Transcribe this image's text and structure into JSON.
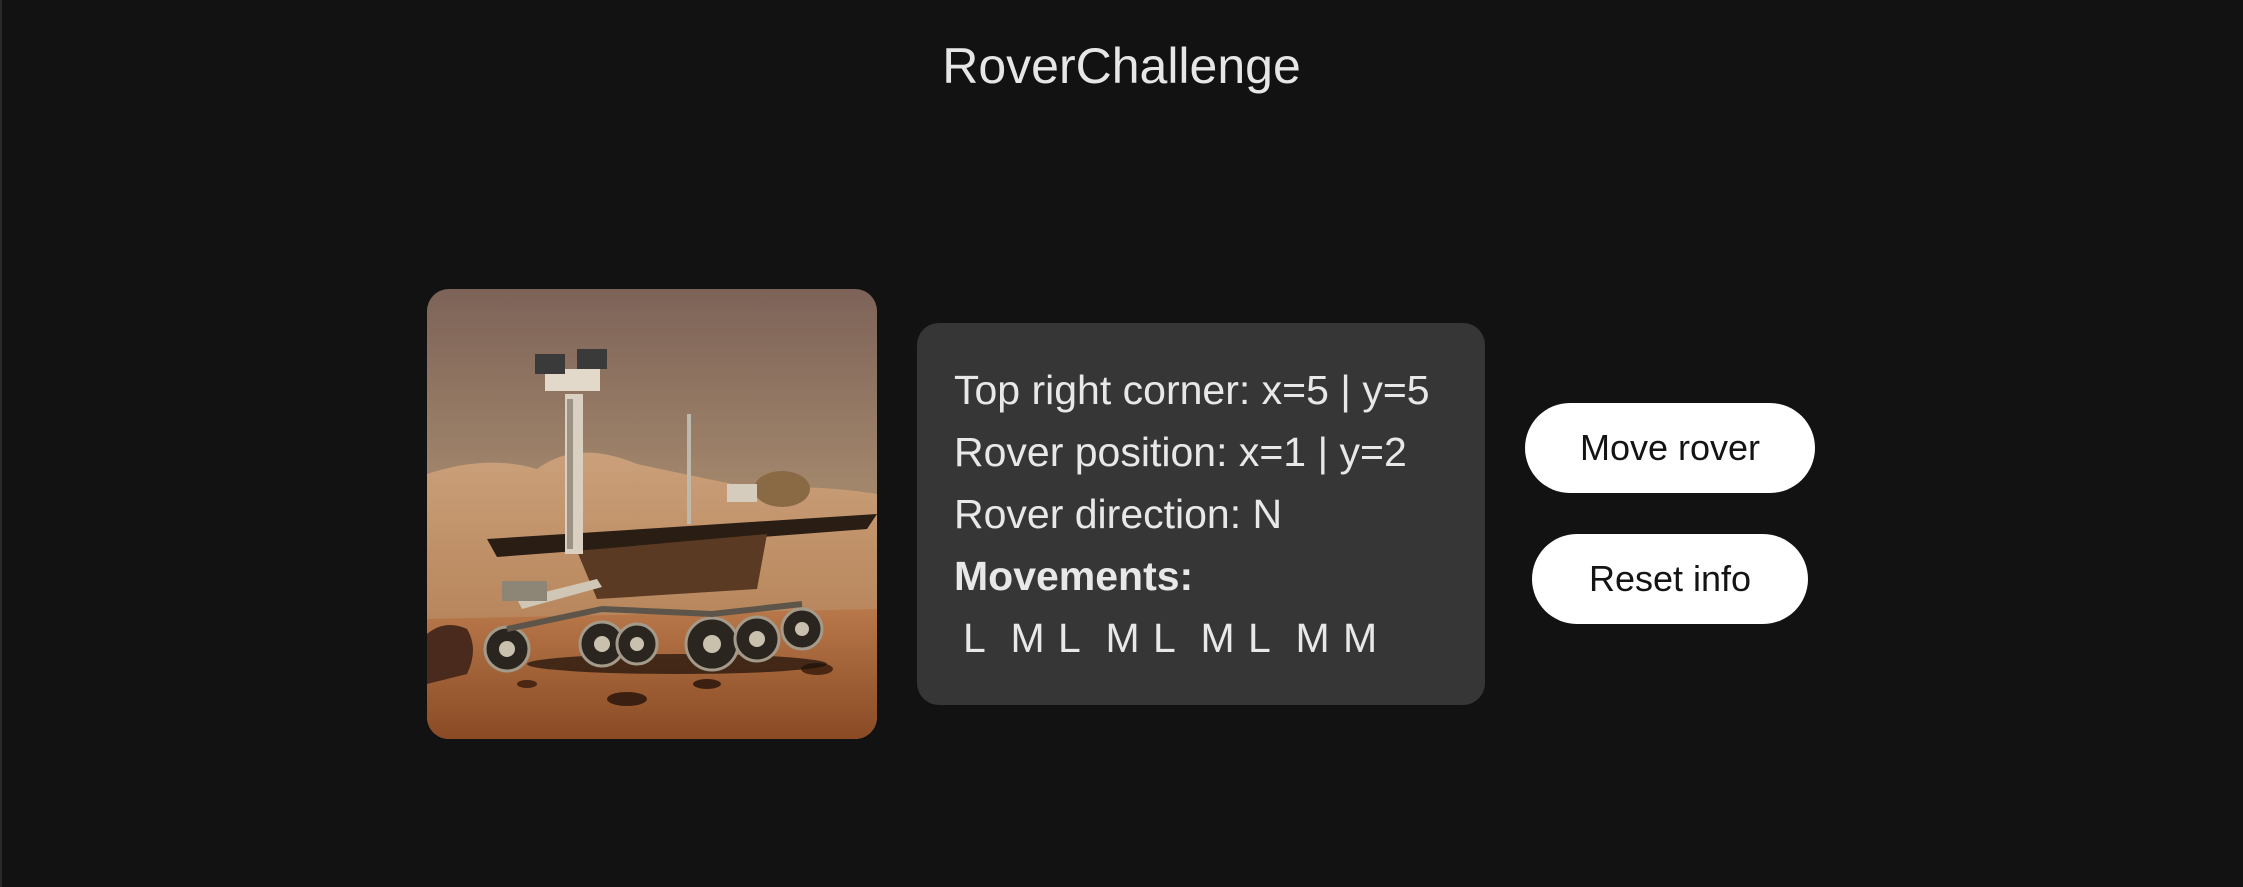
{
  "app": {
    "title": "RoverChallenge"
  },
  "image": {
    "alt": "Mars rover"
  },
  "info": {
    "top_right_corner": "Top right corner: x=5 | y=5",
    "rover_position": "Rover position: x=1 | y=2",
    "rover_direction": "Rover direction: N",
    "movements_label": "Movements:",
    "movements": [
      "L",
      "M",
      "L",
      "M",
      "L",
      "M",
      "L",
      "M",
      "M"
    ]
  },
  "buttons": {
    "move_rover": "Move rover",
    "reset_info": "Reset info"
  },
  "colors": {
    "background": "#121212",
    "card": "#363636",
    "button": "#ffffff",
    "text": "#e8e8e8"
  }
}
